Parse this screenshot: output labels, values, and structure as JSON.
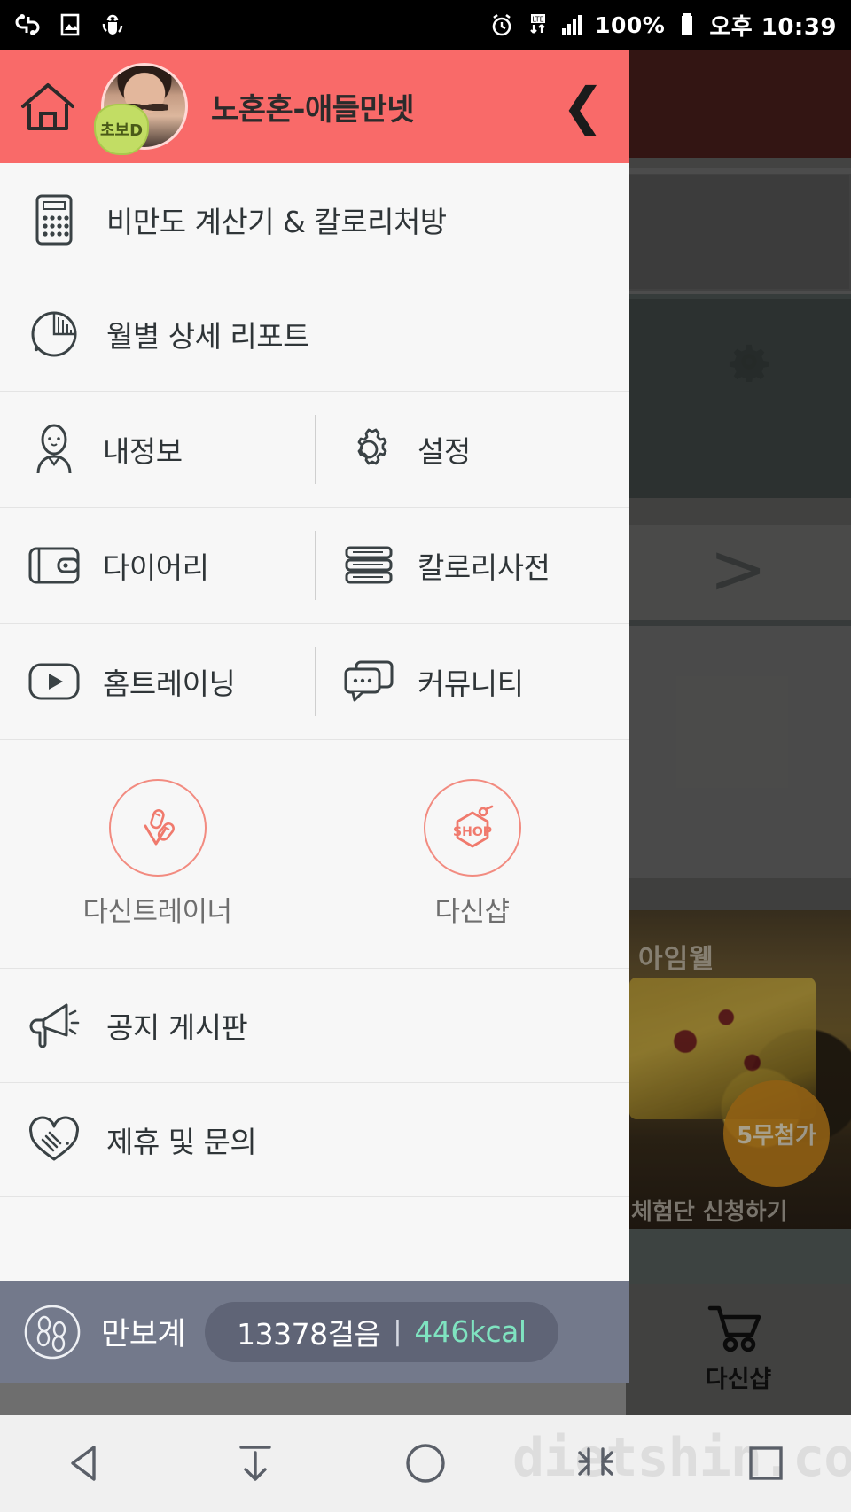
{
  "statusbar": {
    "left_icons": [
      "usb-debug-icon",
      "screenshot-icon",
      "android-sync-icon"
    ],
    "right_icons": [
      "alarm-icon",
      "lte-data-icon",
      "signal-bars-icon",
      "battery-icon"
    ],
    "battery_percent": "100%",
    "time": "오후 10:39"
  },
  "drawer": {
    "home_icon": "home-icon",
    "username": "노혼혼-애들만넷",
    "avatar_badge": "초보D",
    "back_icon": "chevron-left-icon",
    "menu_full": [
      {
        "icon": "calculator-icon",
        "label": "비만도 계산기 & 칼로리처방"
      },
      {
        "icon": "pie-chart-icon",
        "label": "월별 상세 리포트"
      }
    ],
    "menu_pairs": [
      [
        {
          "icon": "person-icon",
          "label": "내정보"
        },
        {
          "icon": "gear-icon",
          "label": "설정"
        }
      ],
      [
        {
          "icon": "wallet-icon",
          "label": "다이어리"
        },
        {
          "icon": "book-icon",
          "label": "칼로리사전"
        }
      ],
      [
        {
          "icon": "play-video-icon",
          "label": "홈트레이닝"
        },
        {
          "icon": "chat-bubble-icon",
          "label": "커뮤니티"
        }
      ]
    ],
    "promos": [
      {
        "icon": "dumbbell-trainer-icon",
        "label": "다신트레이너"
      },
      {
        "icon": "shop-tag-icon",
        "label": "다신샵",
        "icon_text": "SHOP"
      }
    ],
    "menu_bottom": [
      {
        "icon": "megaphone-icon",
        "label": "공지 게시판"
      },
      {
        "icon": "handshake-heart-icon",
        "label": "제휴 및 문의"
      }
    ],
    "pedometer": {
      "icon": "footprints-icon",
      "label": "만보계",
      "steps": "13378걸음",
      "separator": "|",
      "calories": "446kcal"
    },
    "colors": {
      "header": "#f96a69",
      "promo_accent": "#f28b80",
      "pedometer_bar": "#73798b",
      "calories": "#7fe3c0"
    }
  },
  "background_app": {
    "gear_icon": "gear-icon",
    "chevron_icon": "chevron-right-icon",
    "ad_brand": "아임웰",
    "ad_badge": "5무첨가",
    "ad_cta": "체험단 신청하기",
    "tab": {
      "icon": "shopping-cart-icon",
      "label": "다신샵"
    }
  },
  "watermark": {
    "text": "dietshin.com"
  },
  "navbar": {
    "buttons": [
      {
        "icon": "back-triangle-icon"
      },
      {
        "icon": "hide-keyboard-icon"
      },
      {
        "icon": "home-circle-icon"
      },
      {
        "icon": "collapse-icon"
      },
      {
        "icon": "recents-square-icon"
      }
    ]
  }
}
